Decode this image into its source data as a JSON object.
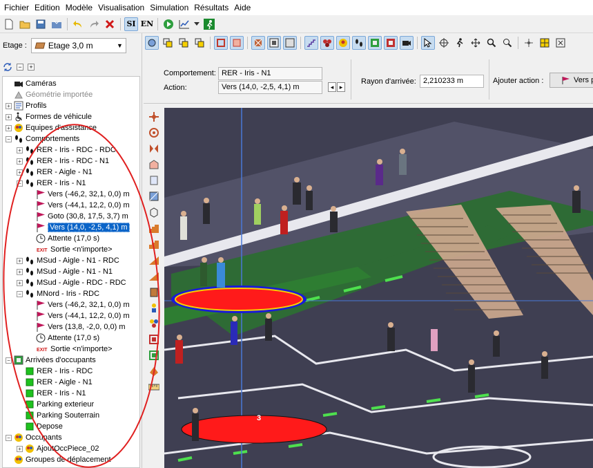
{
  "menu": [
    "Fichier",
    "Edition",
    "Modèle",
    "Visualisation",
    "Simulation",
    "Résultats",
    "Aide"
  ],
  "toolbar": {
    "si_label": "SI",
    "en_label": "EN"
  },
  "etage": {
    "label": "Etage :",
    "value": "Etage 3,0 m"
  },
  "tree": [
    {
      "label": "Caméras",
      "level": 0,
      "toggle": "",
      "icon": "camera-icon",
      "grey": false
    },
    {
      "label": "Géométrie importée",
      "level": 0,
      "toggle": "",
      "icon": "geometry-icon",
      "grey": true
    },
    {
      "label": "Profils",
      "level": 0,
      "toggle": "+",
      "icon": "profile-icon",
      "grey": false
    },
    {
      "label": "Formes de véhicule",
      "level": 0,
      "toggle": "+",
      "icon": "wheelchair-icon",
      "grey": false
    },
    {
      "label": "Equipes d'assistance",
      "level": 0,
      "toggle": "+",
      "icon": "team-icon",
      "grey": false
    },
    {
      "label": "Comportements",
      "level": 0,
      "toggle": "−",
      "icon": "footsteps-icon",
      "grey": false
    },
    {
      "label": "RER - Iris - RDC - RDC",
      "level": 1,
      "toggle": "+",
      "icon": "footsteps-icon",
      "grey": false
    },
    {
      "label": "RER - Iris - RDC - N1",
      "level": 1,
      "toggle": "+",
      "icon": "footsteps-icon",
      "grey": false
    },
    {
      "label": "RER - Aigle - N1",
      "level": 1,
      "toggle": "+",
      "icon": "footsteps-icon",
      "grey": false
    },
    {
      "label": "RER - Iris - N1",
      "level": 1,
      "toggle": "−",
      "icon": "footsteps-icon",
      "grey": false
    },
    {
      "label": "Vers (-46,2, 32,1, 0,0) m",
      "level": 2,
      "toggle": "",
      "icon": "flag-icon",
      "grey": false
    },
    {
      "label": "Vers (-44,1, 12,2, 0,0) m",
      "level": 2,
      "toggle": "",
      "icon": "flag-icon",
      "grey": false
    },
    {
      "label": "Goto (30,8, 17,5, 3,7) m",
      "level": 2,
      "toggle": "",
      "icon": "flag-icon",
      "grey": false
    },
    {
      "label": "Vers (14,0, -2,5, 4,1) m",
      "level": 2,
      "toggle": "",
      "icon": "flag-icon",
      "grey": false,
      "selected": true
    },
    {
      "label": "Attente (17,0 s)",
      "level": 2,
      "toggle": "",
      "icon": "clock-icon",
      "grey": false
    },
    {
      "label": "Sortie <n'importe>",
      "level": 2,
      "toggle": "",
      "icon": "exit-icon",
      "grey": false
    },
    {
      "label": "MSud - Aigle - N1 - RDC",
      "level": 1,
      "toggle": "+",
      "icon": "footsteps-icon",
      "grey": false
    },
    {
      "label": "MSud - Aigle - N1 - N1",
      "level": 1,
      "toggle": "+",
      "icon": "footsteps-icon",
      "grey": false
    },
    {
      "label": "MSud - Aigle - RDC - RDC",
      "level": 1,
      "toggle": "+",
      "icon": "footsteps-icon",
      "grey": false
    },
    {
      "label": "MNord - Iris - RDC",
      "level": 1,
      "toggle": "−",
      "icon": "footsteps-icon",
      "grey": false
    },
    {
      "label": "Vers (-46,2, 32,1, 0,0) m",
      "level": 2,
      "toggle": "",
      "icon": "flag-icon",
      "grey": false
    },
    {
      "label": "Vers (-44,1, 12,2, 0,0) m",
      "level": 2,
      "toggle": "",
      "icon": "flag-icon",
      "grey": false
    },
    {
      "label": "Vers (13,8, -2,0, 0,0) m",
      "level": 2,
      "toggle": "",
      "icon": "flag-icon",
      "grey": false
    },
    {
      "label": "Attente (17,0 s)",
      "level": 2,
      "toggle": "",
      "icon": "clock-icon",
      "grey": false
    },
    {
      "label": "Sortie <n'importe>",
      "level": 2,
      "toggle": "",
      "icon": "exit-icon",
      "grey": false
    },
    {
      "label": "Arrivées d'occupants",
      "level": 0,
      "toggle": "−",
      "icon": "arrivals-icon",
      "grey": false
    },
    {
      "label": "RER - Iris - RDC",
      "level": 1,
      "toggle": "",
      "icon": "green-square-icon",
      "grey": false
    },
    {
      "label": "RER - Aigle - N1",
      "level": 1,
      "toggle": "",
      "icon": "green-square-icon",
      "grey": false
    },
    {
      "label": "RER - Iris - N1",
      "level": 1,
      "toggle": "",
      "icon": "green-square-icon",
      "grey": false
    },
    {
      "label": "Parking exterieur",
      "level": 1,
      "toggle": "",
      "icon": "green-square-icon",
      "grey": false
    },
    {
      "label": "Parking Souterrain",
      "level": 1,
      "toggle": "",
      "icon": "green-square-icon",
      "grey": false
    },
    {
      "label": "Depose",
      "level": 1,
      "toggle": "",
      "icon": "green-square-icon",
      "grey": false
    },
    {
      "label": "Occupants",
      "level": 0,
      "toggle": "−",
      "icon": "team-icon",
      "grey": false
    },
    {
      "label": "AjoutOccPiece_02",
      "level": 1,
      "toggle": "+",
      "icon": "team-icon",
      "grey": false
    },
    {
      "label": "Groupes de déplacement",
      "level": 0,
      "toggle": "",
      "icon": "team-icon",
      "grey": false
    }
  ],
  "props": {
    "comportement_label": "Comportement:",
    "comportement_value": "RER - Iris - N1",
    "action_label": "Action:",
    "action_value": "Vers (14,0, -2,5, 4,1) m",
    "rayon_label": "Rayon d'arrivée:",
    "rayon_value": "2,210233 m",
    "ajouter_label": "Ajouter action :",
    "vers_button": "Vers pos"
  },
  "viewport": {
    "marker_label": "3"
  },
  "colors": {
    "selection": "#0a64c8",
    "annotation": "#e02020",
    "floor": "#3f3f52",
    "green_zone": "#2e7d32",
    "target_disc": "#ff1a1a"
  }
}
